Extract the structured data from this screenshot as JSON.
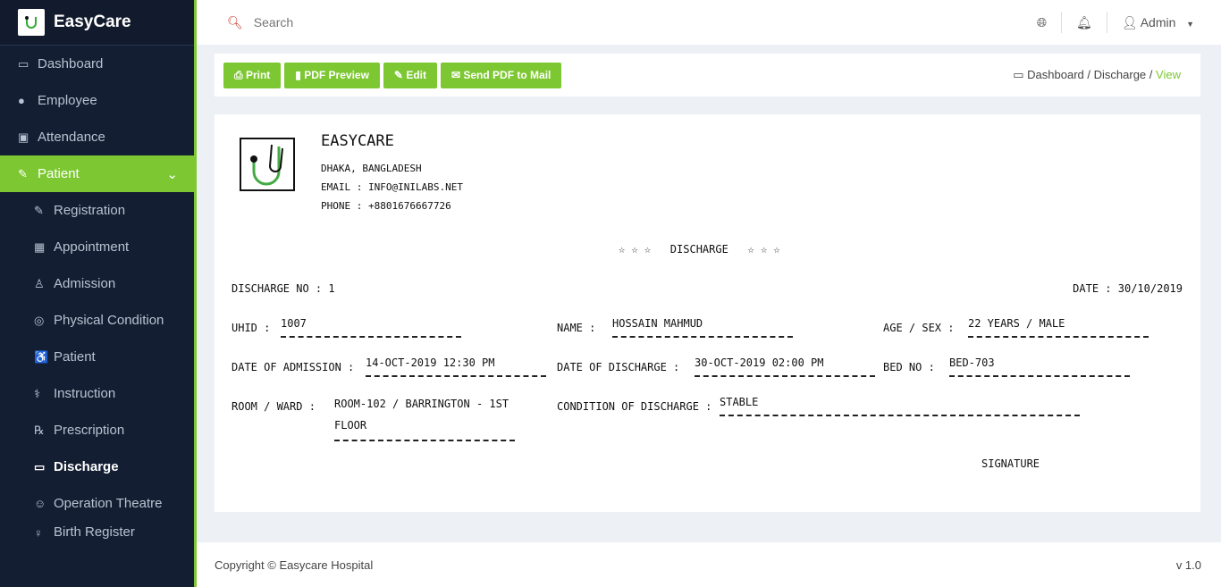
{
  "app": {
    "name": "EasyCare"
  },
  "sidebar": {
    "items": [
      {
        "label": "Dashboard",
        "icon": "laptop-icon"
      },
      {
        "label": "Employee",
        "icon": "user-icon"
      },
      {
        "label": "Attendance",
        "icon": "attendance-icon"
      },
      {
        "label": "Patient",
        "icon": "patient-icon"
      },
      {
        "label": "Registration",
        "icon": "edit-icon"
      },
      {
        "label": "Appointment",
        "icon": "calendar-icon"
      },
      {
        "label": "Admission",
        "icon": "admission-icon"
      },
      {
        "label": "Physical Condition",
        "icon": "target-icon"
      },
      {
        "label": "Patient",
        "icon": "wheelchair-icon"
      },
      {
        "label": "Instruction",
        "icon": "instruction-icon"
      },
      {
        "label": "Prescription",
        "icon": "rx-icon"
      },
      {
        "label": "Discharge",
        "icon": "discharge-icon"
      },
      {
        "label": "Operation Theatre",
        "icon": "theatre-icon"
      },
      {
        "label": "Birth Register",
        "icon": "birth-icon"
      }
    ]
  },
  "topbar": {
    "search_placeholder": "Search",
    "user": "Admin"
  },
  "toolbar": {
    "print": "Print",
    "pdf": "PDF Preview",
    "edit": "Edit",
    "mail": "Send PDF to Mail"
  },
  "breadcrumb": {
    "dashboard": "Dashboard",
    "discharge": "Discharge",
    "view": "View",
    "sep": "/"
  },
  "doc": {
    "org": "EASYCARE",
    "address": "DHAKA, BANGLADESH",
    "email": "EMAIL : INFO@INILABS.NET",
    "phone": "PHONE : +8801676667726",
    "title": "☆ ☆ ☆   DISCHARGE   ☆ ☆ ☆",
    "discharge_no": "DISCHARGE NO : 1",
    "date": "DATE : 30/10/2019",
    "uhid_label": "UHID :",
    "uhid": "1007",
    "name_label": "NAME :",
    "name": "HOSSAIN MAHMUD",
    "age_label": "AGE / SEX :",
    "age": "22 YEARS / MALE",
    "doa_label": "DATE OF ADMISSION :",
    "doa": "14-OCT-2019 12:30 PM",
    "dod_label": "DATE OF DISCHARGE :",
    "dod": "30-OCT-2019 02:00 PM",
    "bed_label": "BED NO :",
    "bed": "BED-703",
    "room_label": "ROOM / WARD :",
    "room": "ROOM-102 / BARRINGTON - 1ST FLOOR",
    "cond_label": "CONDITION OF DISCHARGE :",
    "cond": "STABLE",
    "signature": "SIGNATURE"
  },
  "footer": {
    "copyright": "Copyright © Easycare Hospital",
    "version": "v 1.0"
  }
}
